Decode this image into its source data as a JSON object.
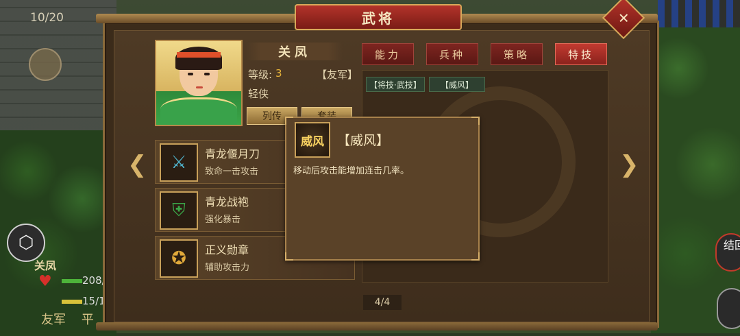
{
  "hud": {
    "counter": "10/20",
    "unit_name": "关凤",
    "unit_hp": "208/",
    "unit_mp": "15/1",
    "unit_faction": "友军",
    "unit_extra": "平",
    "right_button": "结回"
  },
  "window": {
    "title": "武将",
    "close_symbol": "✕"
  },
  "hero": {
    "name": "关凤",
    "level_label": "等级:",
    "level_value": "3",
    "faction": "【友军】",
    "class": "轻侠",
    "buttons": [
      "列传",
      "套装"
    ]
  },
  "equipment": [
    {
      "name": "青龙偃月刀",
      "desc": "致命一击攻击",
      "icon": "blade-icon"
    },
    {
      "name": "青龙战袍",
      "desc": "强化暴击",
      "icon": "armor-icon"
    },
    {
      "name": "正义勋章",
      "desc": "辅助攻击力",
      "icon": "medal-icon"
    }
  ],
  "tabs": [
    {
      "label": "能力",
      "active": false
    },
    {
      "label": "兵种",
      "active": false
    },
    {
      "label": "策略",
      "active": false
    },
    {
      "label": "特技",
      "active": true
    }
  ],
  "skill_tags": [
    "【将技·武技】",
    "【威风】"
  ],
  "page_indicator": "4/4",
  "tooltip": {
    "icon_text": "威风",
    "title": "【威风】",
    "desc": "移动后攻击能增加连击几率。"
  },
  "arrows": {
    "left": "❮",
    "right": "❯"
  },
  "colors": {
    "accent_red": "#b3332a",
    "gold": "#d8a95a",
    "level": "#e8b43a"
  }
}
